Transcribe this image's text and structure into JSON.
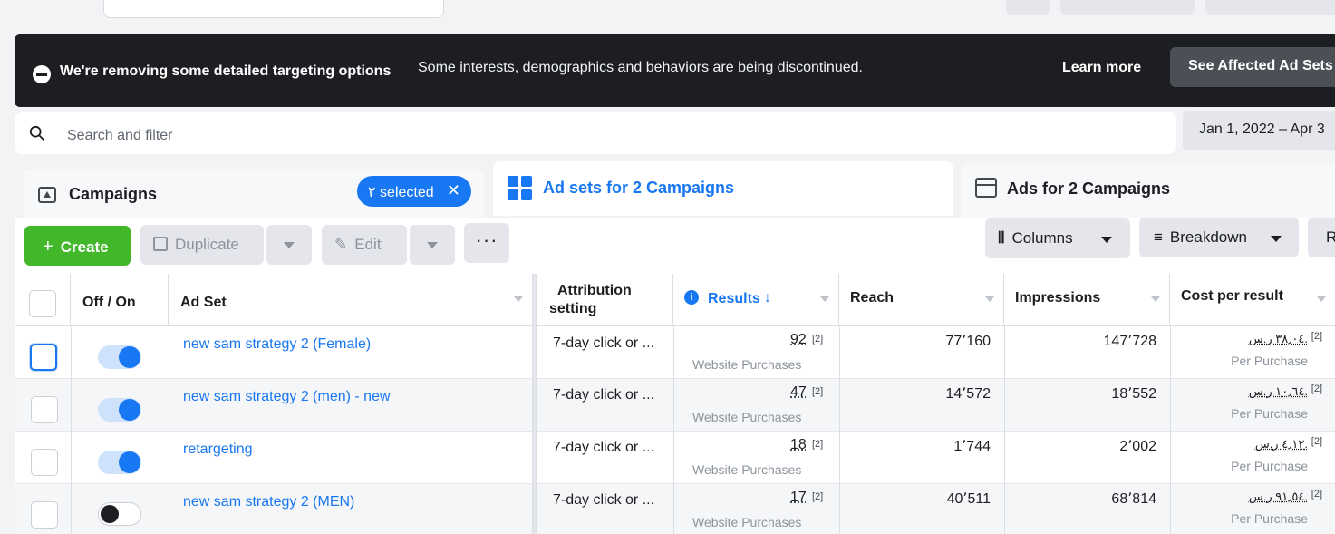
{
  "banner": {
    "title": "We're removing some detailed targeting options",
    "description": "Some interests, demographics and behaviors are being discontinued.",
    "learn_more": "Learn more",
    "see_affected": "See Affected Ad Sets"
  },
  "search": {
    "placeholder": "Search and filter"
  },
  "date_range": "Jan 1, 2022 – Apr 3",
  "tabs": {
    "campaigns": "Campaigns",
    "selected_badge": "٢ selected",
    "ad_sets": "Ad sets for 2 Campaigns",
    "ads": "Ads for 2 Campaigns"
  },
  "toolbar": {
    "create": "Create",
    "duplicate": "Duplicate",
    "edit": "Edit",
    "more": "···",
    "columns": "Columns",
    "breakdown": "Breakdown",
    "reports": "R"
  },
  "table": {
    "headers": {
      "off_on": "Off / On",
      "ad_set": "Ad Set",
      "attribution_line1": "Attribution",
      "attribution_line2": "setting",
      "results": "Results",
      "reach": "Reach",
      "impressions": "Impressions",
      "cost_per_result": "Cost per result"
    },
    "rows": [
      {
        "name": "new sam strategy 2 (Female)",
        "attribution": "7-day click or ...",
        "results": "92",
        "results_note": "[2]",
        "results_type": "Website Purchases",
        "reach": "77٬160",
        "impressions": "147٬728",
        "cost": "٣٨٫٠٤ ر.س.",
        "cost_note": "[2]",
        "cost_type": "Per Purchase",
        "toggle_on": true
      },
      {
        "name": "new sam strategy 2 (men) - new",
        "attribution": "7-day click or ...",
        "results": "47",
        "results_note": "[2]",
        "results_type": "Website Purchases",
        "reach": "14٬572",
        "impressions": "18٬552",
        "cost": "١٠٫٦٤ ر.س.",
        "cost_note": "[2]",
        "cost_type": "Per Purchase",
        "toggle_on": true
      },
      {
        "name": "retargeting",
        "attribution": "7-day click or ...",
        "results": "18",
        "results_note": "[2]",
        "results_type": "Website Purchases",
        "reach": "1٬744",
        "impressions": "2٬002",
        "cost": "٤٫١٢ ر.س.",
        "cost_note": "[2]",
        "cost_type": "Per Purchase",
        "toggle_on": true
      },
      {
        "name": "new sam strategy 2 (MEN)",
        "attribution": "7-day click or ...",
        "results": "17",
        "results_note": "[2]",
        "results_type": "Website Purchases",
        "reach": "40٬511",
        "impressions": "68٬814",
        "cost": "٩١٫٥٤ ر.س.",
        "cost_note": "[2]",
        "cost_type": "Per Purchase",
        "toggle_on": false
      }
    ]
  },
  "colors": {
    "accent": "#1877f2",
    "create_green": "#42b72a",
    "banner_bg": "#1c1e21"
  }
}
